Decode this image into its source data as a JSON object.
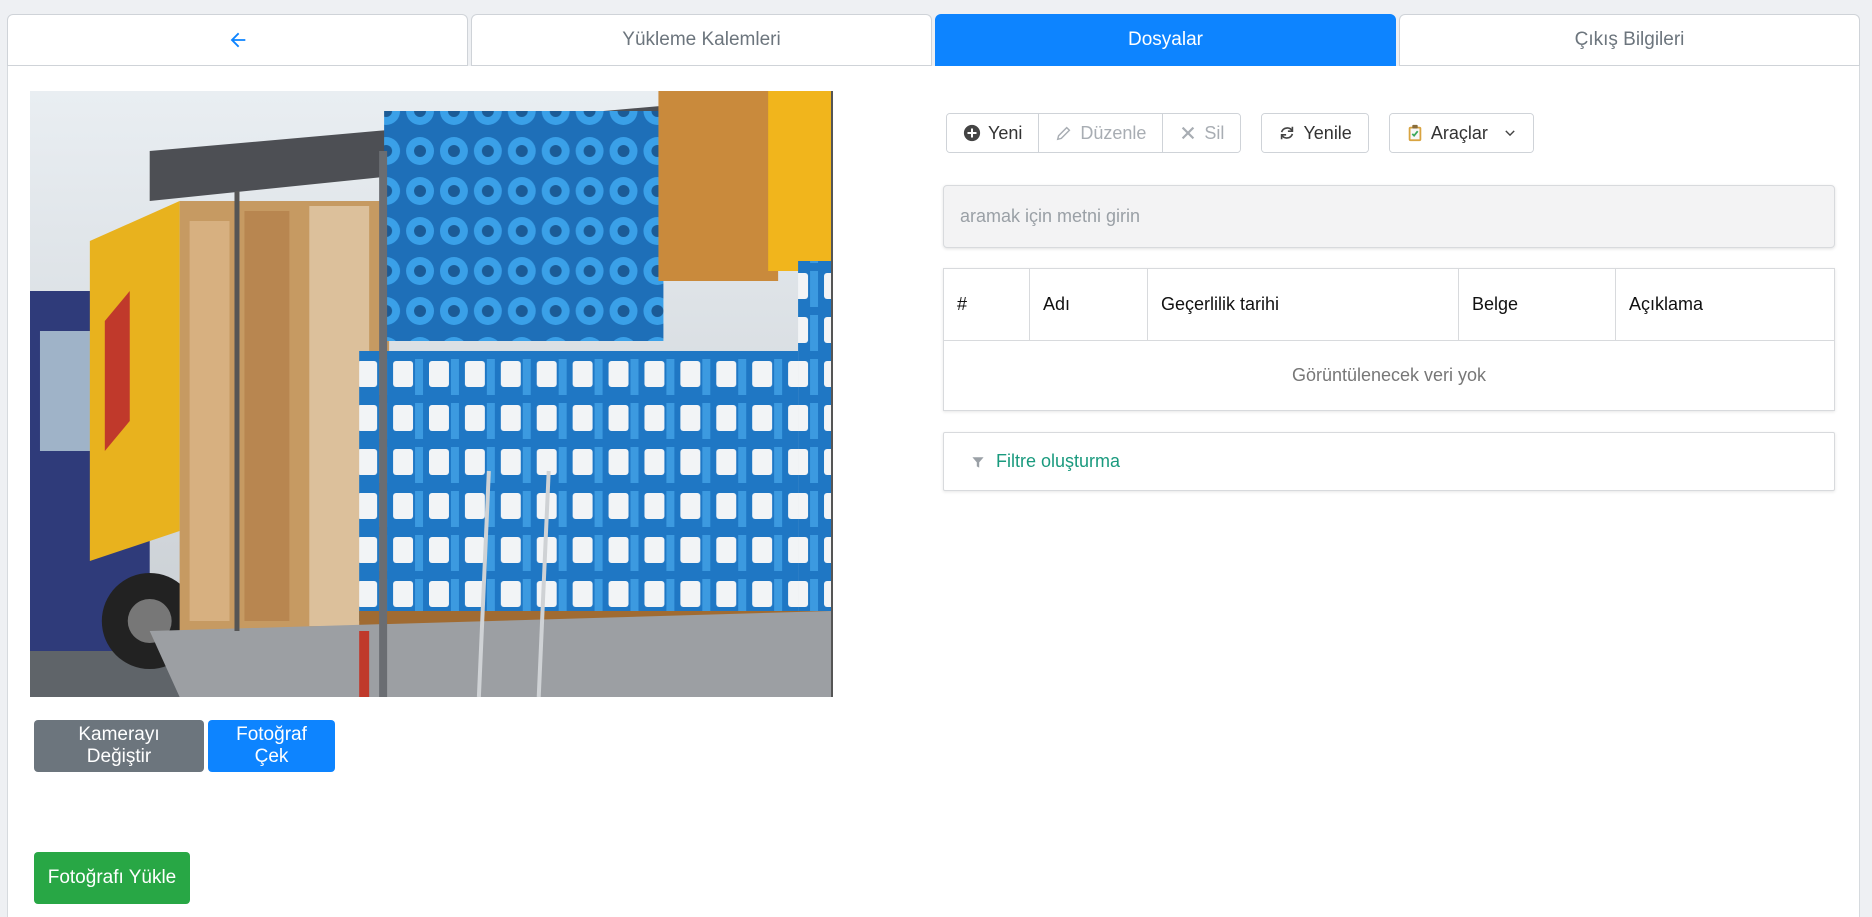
{
  "tabs": [
    {
      "label": "",
      "icon": "arrow-left-icon",
      "active": false
    },
    {
      "label": "Yükleme Kalemleri",
      "active": false
    },
    {
      "label": "Dosyalar",
      "active": true
    },
    {
      "label": "Çıkış Bilgileri",
      "active": false
    }
  ],
  "camera": {
    "switch_label": "Kamerayı Değiştir",
    "capture_label": "Fotoğraf Çek",
    "upload_label": "Fotoğrafı Yükle"
  },
  "toolbar": {
    "new_label": "Yeni",
    "edit_label": "Düzenle",
    "delete_label": "Sil",
    "refresh_label": "Yenile",
    "tools_label": "Araçlar"
  },
  "search": {
    "placeholder": "aramak için metni girin"
  },
  "table": {
    "columns": [
      "#",
      "Adı",
      "Geçerlilik tarihi",
      "Belge",
      "Açıklama"
    ],
    "empty_text": "Görüntülenecek veri yok"
  },
  "filter": {
    "label": "Filtre oluşturma"
  },
  "colors": {
    "primary": "#0d84ff",
    "secondary": "#6c757d",
    "success": "#28a745",
    "filter_text": "#1a9a7e"
  }
}
